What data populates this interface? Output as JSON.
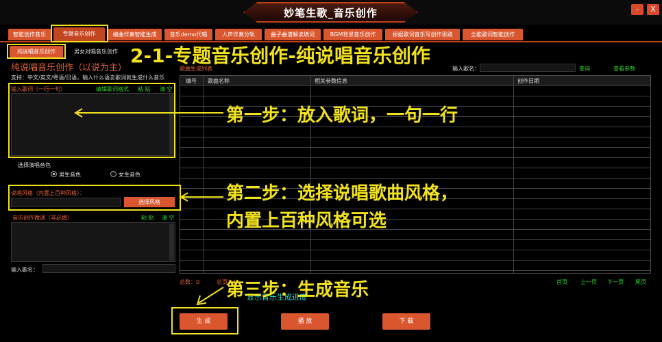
{
  "window": {
    "title": "妙笔生歌_音乐创作",
    "minimize": "-",
    "close": "X"
  },
  "tabs": [
    {
      "label": "智能创作音乐"
    },
    {
      "label": "专题音乐创作"
    },
    {
      "label": "编曲伴奏智能生成"
    },
    {
      "label": "音乐demo代唱"
    },
    {
      "label": "人声伴奏分轨"
    },
    {
      "label": "曲子曲谱解读填词"
    },
    {
      "label": "BGM背景音乐创作"
    },
    {
      "label": "根据歌词音乐写创作思路"
    },
    {
      "label": "全能歌词智能创作"
    }
  ],
  "subtabs": [
    {
      "label": "纯说唱音乐创作"
    },
    {
      "label": "男女对唱音乐创作"
    }
  ],
  "left": {
    "section_title": "纯说唱音乐创作（以说为主）",
    "support_text": "支持：中文/英文/粤语/日语，输入什么语言歌词就生成什么音乐",
    "lyrics_label": "输入歌词（一行一句）",
    "lyrics_edit": "编辑歌词格式",
    "paste": "粘 贴",
    "clear": "清 空",
    "voice_label": "选择演唱音色",
    "voice_male": "男生音色",
    "voice_female": "女生音色",
    "style_label": "说唱风格（内置上百种风格）：",
    "style_button": "选择风格",
    "tune_label": "音乐创作微调（非必填）",
    "name_label": "输入歌名："
  },
  "right": {
    "song_list_label": "歌曲生成列表",
    "input_song_label": "输入歌名：",
    "query": "查询",
    "view_params": "查看参数",
    "columns": [
      "编号",
      "歌曲名称",
      "相关参数信息",
      "创作日期"
    ],
    "total_count": "总数：0",
    "total_pages": "总页：1",
    "first_page": "首页",
    "prev_page": "上一页",
    "next_page": "下一页",
    "last_page": "尾页",
    "progress_text": "显示音乐生成进度"
  },
  "actions": {
    "generate": "生 成",
    "play": "播 放",
    "download": "下 载"
  },
  "annotations": {
    "heading": "2-1-专题音乐创作-纯说唱音乐创作",
    "step1": "第一步：放入歌词，一句一行",
    "step2a": "第二步：选择说唱歌曲风格，",
    "step2b": "内置上百种风格可选",
    "step3": "第三步：生成音乐"
  },
  "colors": {
    "accent": "#d9562e",
    "annotation": "#f2e21e",
    "green_link": "#2fd52f",
    "progress": "#2bd6c8"
  }
}
